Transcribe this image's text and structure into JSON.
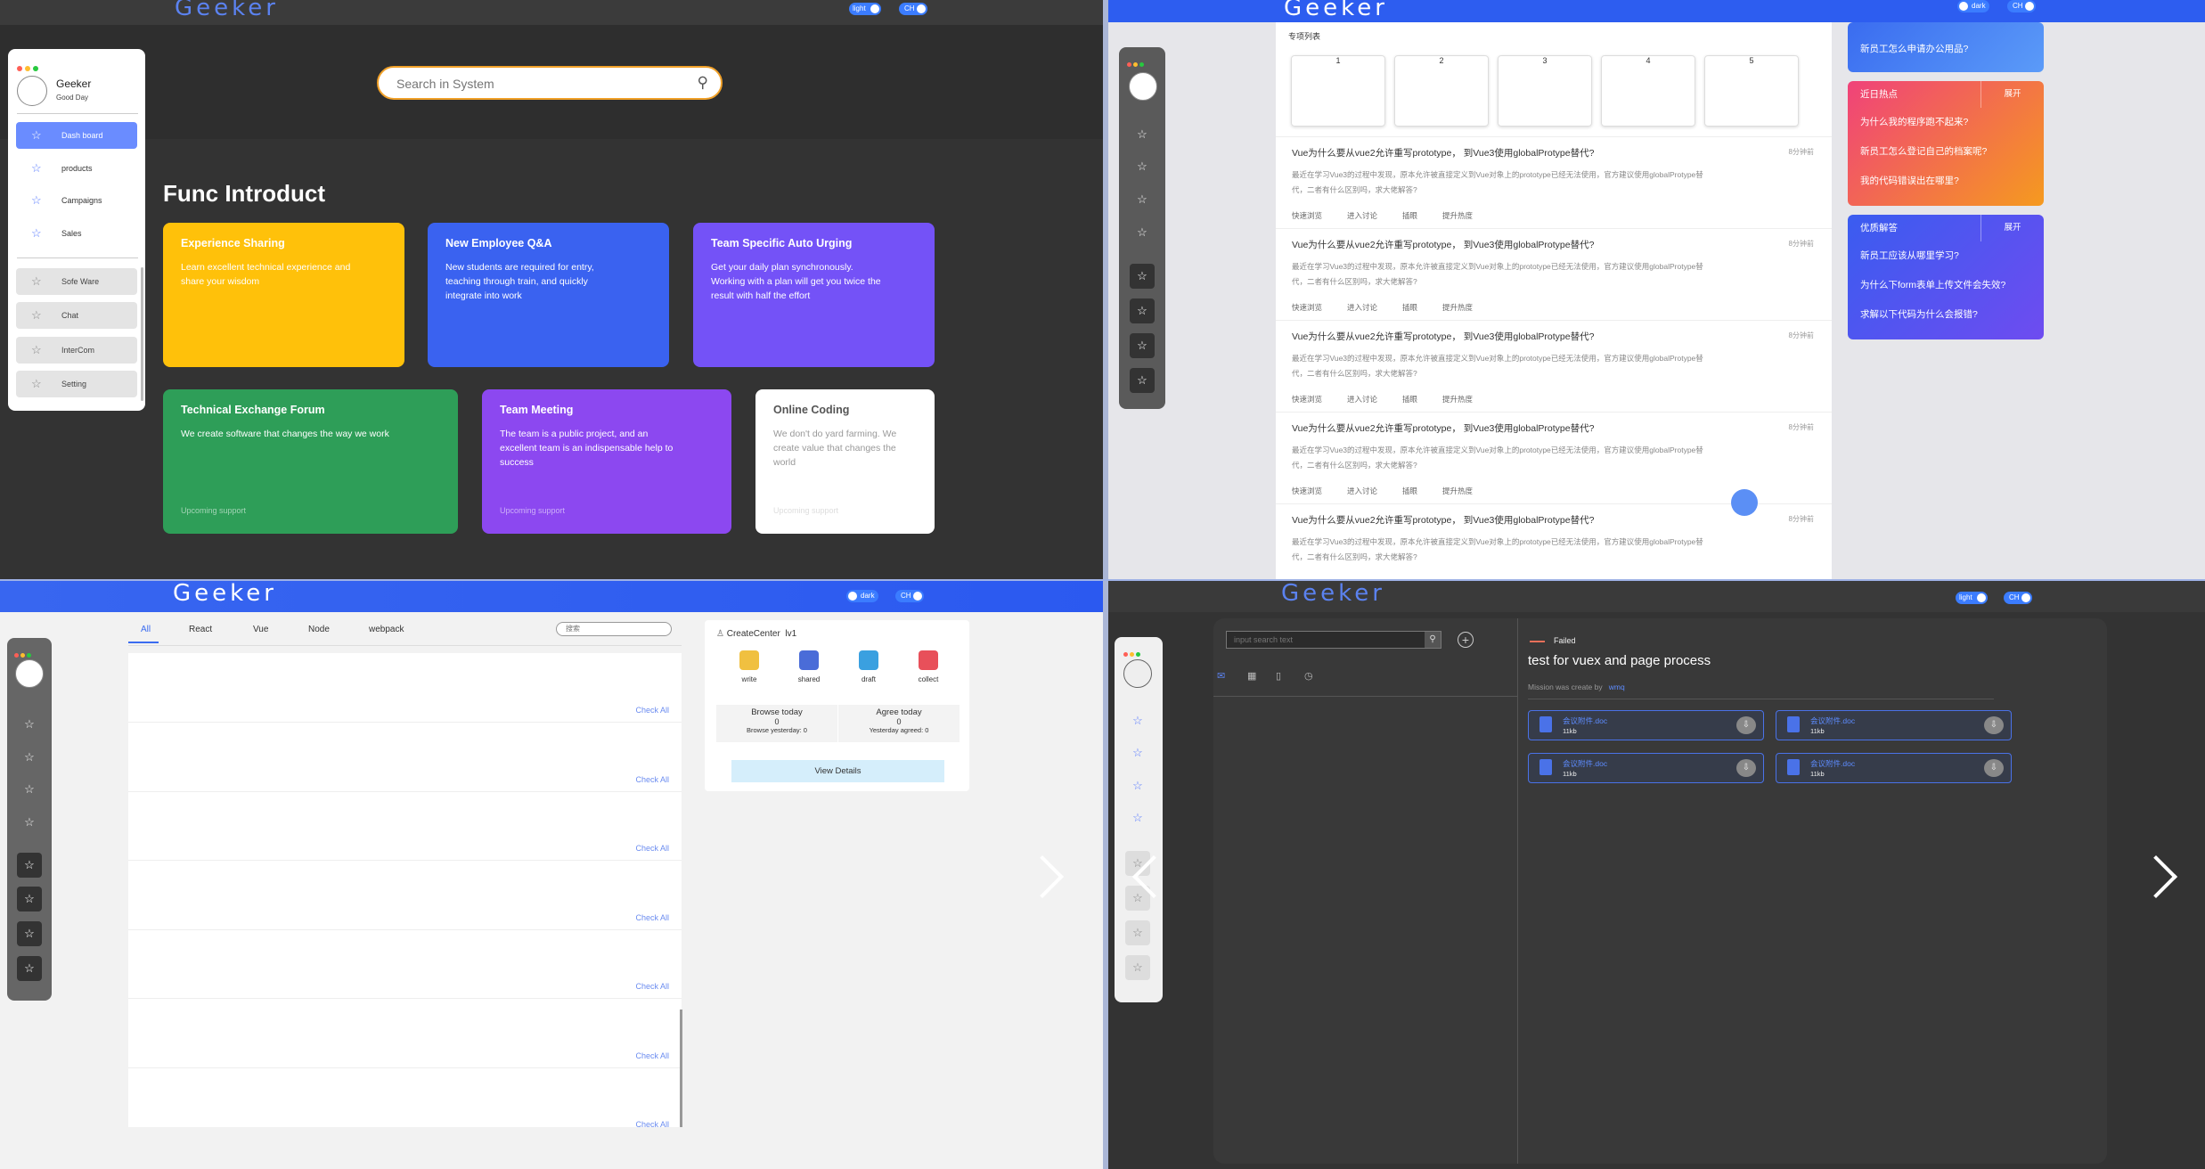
{
  "brand": "Geeker",
  "q1": {
    "toggle_light": "light",
    "toggle_lang": "CH",
    "search_placeholder": "Search in System",
    "profile_name": "Geeker",
    "profile_greeting": "Good Day",
    "nav": [
      "Dash board",
      "products",
      "Campaigns",
      "Sales"
    ],
    "nav_secondary": [
      "Sofe Ware",
      "Chat",
      "InterCom",
      "Setting"
    ],
    "section_title": "Func Introduct",
    "cards": [
      {
        "title": "Experience Sharing",
        "text": "Learn excellent technical experience and share your wisdom",
        "color": "#ffc10a"
      },
      {
        "title": "New Employee Q&A",
        "text": "New students are required for entry, teaching through train, and quickly integrate into work",
        "color": "#3a62f0"
      },
      {
        "title": "Team Specific Auto Urging",
        "text": "Get your daily plan synchronously. Working with a plan will get you twice the result with half the effort",
        "color": "#7452f7"
      },
      {
        "title": "Technical Exchange Forum",
        "text": "We create software that changes the way we work",
        "note": "Upcoming support",
        "color": "#2e9e58"
      },
      {
        "title": "Team Meeting",
        "text": "The team is a public project, and an excellent team is an indispensable help to success",
        "note": "Upcoming support",
        "color": "#8c48f0"
      },
      {
        "title": "Online Coding",
        "text": "We don't do yard farming. We create value that changes the world",
        "note": "Upcoming support",
        "color": "#ffffff"
      }
    ]
  },
  "q2": {
    "toggle_dark": "dark",
    "toggle_lang": "CH",
    "project_list_title": "专项列表",
    "projects": [
      "1",
      "2",
      "3",
      "4",
      "5"
    ],
    "posts": [
      {
        "title": "Vue为什么要从vue2允许重写prototype， 到Vue3使用globalProtype替代?",
        "time": "8分钟前",
        "desc": "最近在学习Vue3的过程中发现，原本允许被直接定义到Vue对象上的prototype已经无法使用，官方建议使用globalProtype替代，二者有什么区别吗，求大佬解答?"
      },
      {
        "title": "Vue为什么要从vue2允许重写prototype， 到Vue3使用globalProtype替代?",
        "time": "8分钟前",
        "desc": "最近在学习Vue3的过程中发现，原本允许被直接定义到Vue对象上的prototype已经无法使用，官方建议使用globalProtype替代，二者有什么区别吗，求大佬解答?"
      },
      {
        "title": "Vue为什么要从vue2允许重写prototype， 到Vue3使用globalProtype替代?",
        "time": "8分钟前",
        "desc": "最近在学习Vue3的过程中发现，原本允许被直接定义到Vue对象上的prototype已经无法使用，官方建议使用globalProtype替代，二者有什么区别吗，求大佬解答?"
      },
      {
        "title": "Vue为什么要从vue2允许重写prototype， 到Vue3使用globalProtype替代?",
        "time": "8分钟前",
        "desc": "最近在学习Vue3的过程中发现，原本允许被直接定义到Vue对象上的prototype已经无法使用，官方建议使用globalProtype替代，二者有什么区别吗，求大佬解答?"
      },
      {
        "title": "Vue为什么要从vue2允许重写prototype， 到Vue3使用globalProtype替代?",
        "time": "8分钟前",
        "desc": "最近在学习Vue3的过程中发现，原本允许被直接定义到Vue对象上的prototype已经无法使用，官方建议使用globalProtype替代，二者有什么区别吗，求大佬解答?"
      }
    ],
    "actions": [
      "快速浏览",
      "进入讨论",
      "插眼",
      "提升热度"
    ],
    "top_item": "新员工怎么申请办公用品?",
    "hot_title": "近日热点",
    "expand_label": "展开",
    "hot_items": [
      "为什么我的程序跑不起来?",
      "新员工怎么登记自己的档案呢?",
      "我的代码错误出在哪里?"
    ],
    "good_title": "优质解答",
    "good_items": [
      "新员工应该从哪里学习?",
      "为什么下form表单上传文件会失效?",
      "求解以下代码为什么会报错?"
    ]
  },
  "q3": {
    "toggle_dark": "dark",
    "toggle_lang": "CH",
    "tabs": [
      "All",
      "React",
      "Vue",
      "Node",
      "webpack"
    ],
    "search_placeholder": "搜索",
    "check_all": "Check All",
    "create_center": "CreateCenter",
    "level": "lv1",
    "tools": [
      {
        "label": "write",
        "color": "#f0c040"
      },
      {
        "label": "shared",
        "color": "#4a6cd8"
      },
      {
        "label": "draft",
        "color": "#3aa0e0"
      },
      {
        "label": "collect",
        "color": "#e8505a"
      }
    ],
    "browse_today_label": "Browse today",
    "browse_today": "0",
    "browse_yesterday": "Browse yesterday: 0",
    "agree_today_label": "Agree today",
    "agree_today": "0",
    "agree_yesterday": "Yesterday agreed: 0",
    "view_details": "View Details"
  },
  "q4": {
    "toggle_light": "light",
    "toggle_lang": "CH",
    "search_placeholder": "input search text",
    "status": "Failed",
    "task_title": "test for vuex and page process",
    "created_by_label": "Mission was create by",
    "creator": "wmq",
    "files": [
      {
        "name": "会议附件.doc",
        "size": "11kb"
      },
      {
        "name": "会议附件.doc",
        "size": "11kb"
      },
      {
        "name": "会议附件.doc",
        "size": "11kb"
      },
      {
        "name": "会议附件.doc",
        "size": "11kb"
      }
    ]
  }
}
